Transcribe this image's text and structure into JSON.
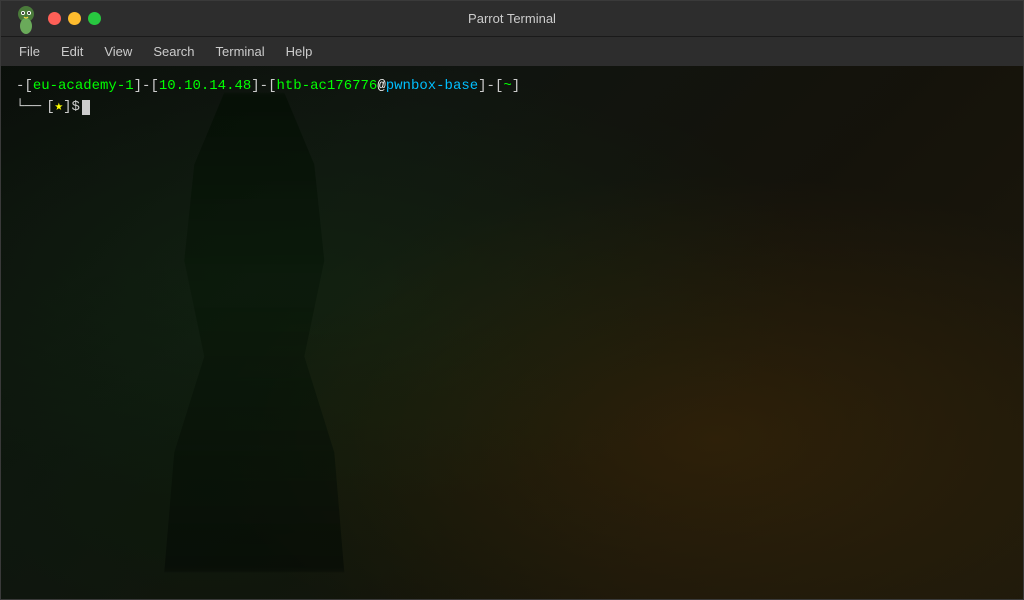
{
  "titleBar": {
    "title": "Parrot Terminal",
    "buttons": {
      "close": "close",
      "minimize": "minimize",
      "maximize": "maximize"
    }
  },
  "menuBar": {
    "items": [
      "File",
      "Edit",
      "View",
      "Search",
      "Terminal",
      "Help"
    ]
  },
  "terminal": {
    "prompt": {
      "line1": {
        "prefix": "-[",
        "segment1": "eu-academy-1",
        "sep1": "]-[",
        "segment2": "10.10.14.48",
        "sep2": "]-[",
        "user": "htb-ac176776",
        "at": "@",
        "host": "pwnbox-base",
        "sep3": "]-[",
        "tilde": "~",
        "suffix": "]"
      },
      "line2": {
        "arrow": "└──",
        "open": "[",
        "star": "★",
        "close": "]$"
      }
    }
  }
}
